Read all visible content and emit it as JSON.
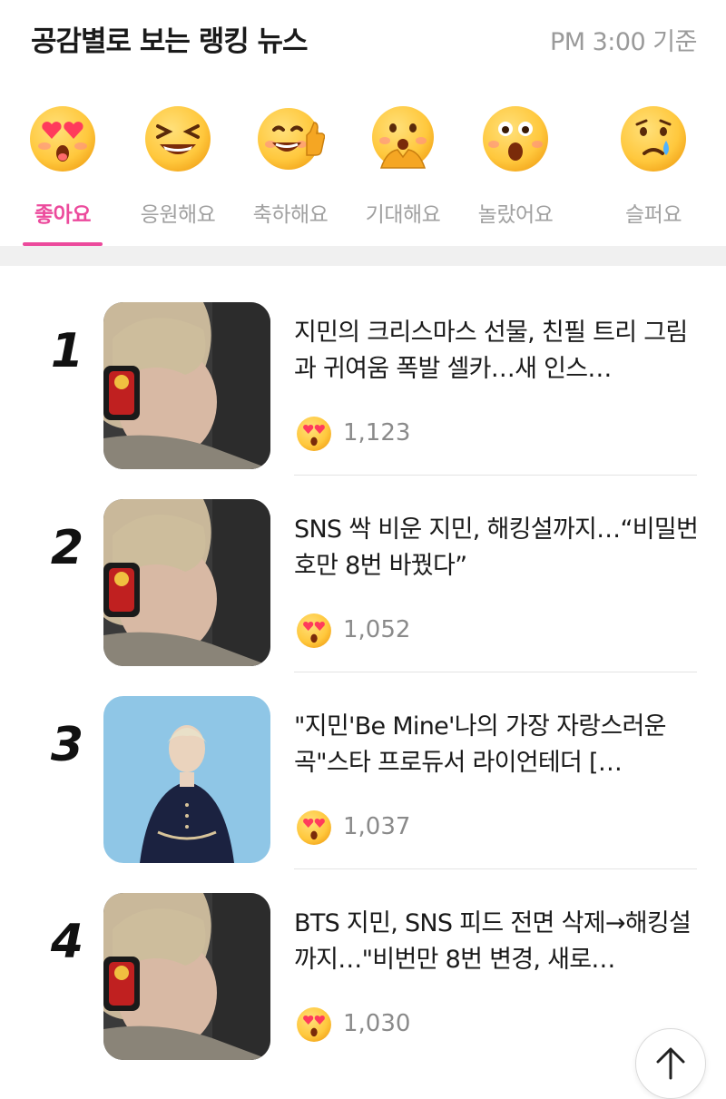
{
  "header": {
    "title": "공감별로 보는 랭킹 뉴스",
    "time": "PM 3:00 기준"
  },
  "tabs": [
    {
      "label": "좋아요",
      "icon": "heart-eyes-emoji-icon",
      "active": true
    },
    {
      "label": "응원해요",
      "icon": "laughing-emoji-icon",
      "active": false
    },
    {
      "label": "축하해요",
      "icon": "thumbs-up-emoji-icon",
      "active": false
    },
    {
      "label": "기대해요",
      "icon": "hopeful-emoji-icon",
      "active": false
    },
    {
      "label": "놀랐어요",
      "icon": "surprised-emoji-icon",
      "active": false
    },
    {
      "label": "슬퍼요",
      "icon": "crying-emoji-icon",
      "active": false
    }
  ],
  "news": [
    {
      "rank": "1",
      "headline": "지민의 크리스마스 선물, 친필 트리 그림과 귀여움 폭발 셀카…새 인스…",
      "likes": "1,123",
      "thumb": "selfie-photo"
    },
    {
      "rank": "2",
      "headline": "SNS 싹 비운 지민, 해킹설까지…“비밀번호만 8번 바꿨다”",
      "likes": "1,052",
      "thumb": "selfie-photo"
    },
    {
      "rank": "3",
      "headline": "\"지민'Be Mine'나의 가장 자랑스러운 곡\"스타 프로듀서 라이언테더 […",
      "likes": "1,037",
      "thumb": "portrait-photo"
    },
    {
      "rank": "4",
      "headline": "BTS 지민, SNS 피드 전면 삭제→해킹설까지…\"비번만 8번 변경, 새로…",
      "likes": "1,030",
      "thumb": "selfie-photo"
    }
  ],
  "colors": {
    "accent": "#ec4a9c",
    "emoji_yellow": "#ffc83d",
    "divider": "#e4e4e4"
  },
  "scroll_top_icon": "arrow-up-icon"
}
